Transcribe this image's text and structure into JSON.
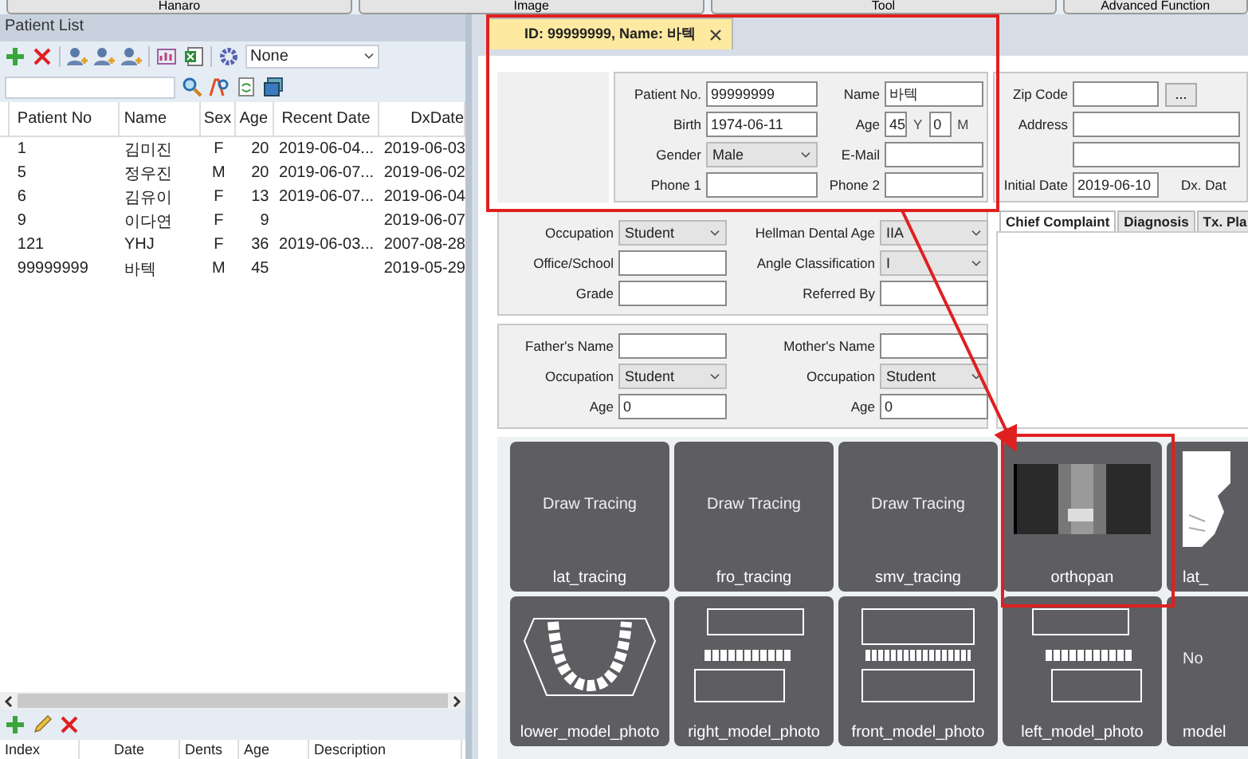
{
  "menu_tabs": [
    {
      "label": "Hanaro"
    },
    {
      "label": "Image"
    },
    {
      "label": "Tool"
    },
    {
      "label": "Advanced Function"
    }
  ],
  "patient_list": {
    "title": "Patient List",
    "filter": "None",
    "columns": [
      "Patient No",
      "Name",
      "Sex",
      "Age",
      "Recent Date",
      "DxDate"
    ],
    "rows": [
      [
        "1",
        "김미진",
        "F",
        "20",
        "2019-06-04...",
        "2019-06-03"
      ],
      [
        "5",
        "정우진",
        "M",
        "20",
        "2019-06-07...",
        "2019-06-02"
      ],
      [
        "6",
        "김유이",
        "F",
        "13",
        "2019-06-07...",
        "2019-06-04"
      ],
      [
        "9",
        "이다연",
        "F",
        "9",
        "",
        "2019-06-07"
      ],
      [
        "121",
        "YHJ",
        "F",
        "36",
        "2019-06-03...",
        "2007-08-28"
      ],
      [
        "99999999",
        "바텍",
        "M",
        "45",
        "",
        "2019-05-29"
      ]
    ]
  },
  "records": {
    "columns": [
      "Index",
      "Date",
      "Dents",
      "Age",
      "Description"
    ]
  },
  "document_tabs": [
    {
      "label": "ID: 99999999, Name: 바텍",
      "selected": true
    }
  ],
  "patient_form": [
    {
      "kind": "text",
      "label": "Patient No.",
      "value": "99999999"
    },
    {
      "kind": "text",
      "label": "Name",
      "value": "바텍"
    },
    {
      "kind": "text",
      "label": "Birth",
      "value": "1974-06-11"
    },
    {
      "kind": "age",
      "label": "Age",
      "years": "45",
      "years_unit": "Y",
      "months": "0",
      "months_unit": "M"
    },
    {
      "kind": "select",
      "label": "Gender",
      "value": "Male"
    },
    {
      "kind": "text",
      "label": "E-Mail"
    },
    {
      "kind": "text",
      "label": "Phone 1"
    },
    {
      "kind": "text",
      "label": "Phone 2"
    }
  ],
  "address_form": [
    {
      "kind": "zip",
      "label": "Zip Code",
      "button": "..."
    },
    {
      "kind": "text",
      "label": "Address"
    },
    {
      "kind": "text"
    },
    {
      "kind": "date",
      "label": "Initial Date",
      "value": "2019-06-10",
      "extra_label": "Dx. Dat"
    }
  ],
  "details_form": [
    {
      "kind": "select",
      "label": "Occupation",
      "value": "Student"
    },
    {
      "kind": "select",
      "label": "Hellman Dental Age",
      "value": "IIA"
    },
    {
      "kind": "text",
      "label": "Office/School"
    },
    {
      "kind": "select",
      "label": "Angle Classification",
      "value": "I"
    },
    {
      "kind": "text",
      "label": "Grade"
    },
    {
      "kind": "text",
      "label": "Referred By"
    }
  ],
  "parents_form": [
    {
      "kind": "text",
      "label": "Father's Name"
    },
    {
      "kind": "text",
      "label": "Mother's Name"
    },
    {
      "kind": "select",
      "label": "Occupation",
      "value": "Student"
    },
    {
      "kind": "select",
      "label": "Occupation",
      "value": "Student"
    },
    {
      "kind": "text",
      "label": "Age",
      "value": "0"
    },
    {
      "kind": "text",
      "label": "Age",
      "value": "0"
    }
  ],
  "notes_tabs": [
    {
      "label": "Chief Complaint",
      "selected": true
    },
    {
      "label": "Diagnosis",
      "selected": false
    },
    {
      "label": "Tx. Pla",
      "selected": false
    }
  ],
  "gallery": [
    {
      "kind": "tracing",
      "action": "Draw Tracing",
      "label": "lat_tracing"
    },
    {
      "kind": "tracing",
      "action": "Draw Tracing",
      "label": "fro_tracing"
    },
    {
      "kind": "tracing",
      "action": "Draw Tracing",
      "label": "smv_tracing"
    },
    {
      "label": "orthopan"
    },
    {
      "label": "lat_"
    },
    {
      "kind": "arch",
      "label": "lower_model_photo"
    },
    {
      "kind": "right",
      "label": "right_model_photo"
    },
    {
      "kind": "front",
      "label": "front_model_photo"
    },
    {
      "kind": "left",
      "label": "left_model_photo"
    },
    {
      "kind": "empty",
      "message": "No",
      "label": "model"
    }
  ],
  "annotations": [
    {
      "kind": "frame"
    },
    {
      "kind": "frame"
    },
    {
      "kind": "arrow"
    }
  ]
}
